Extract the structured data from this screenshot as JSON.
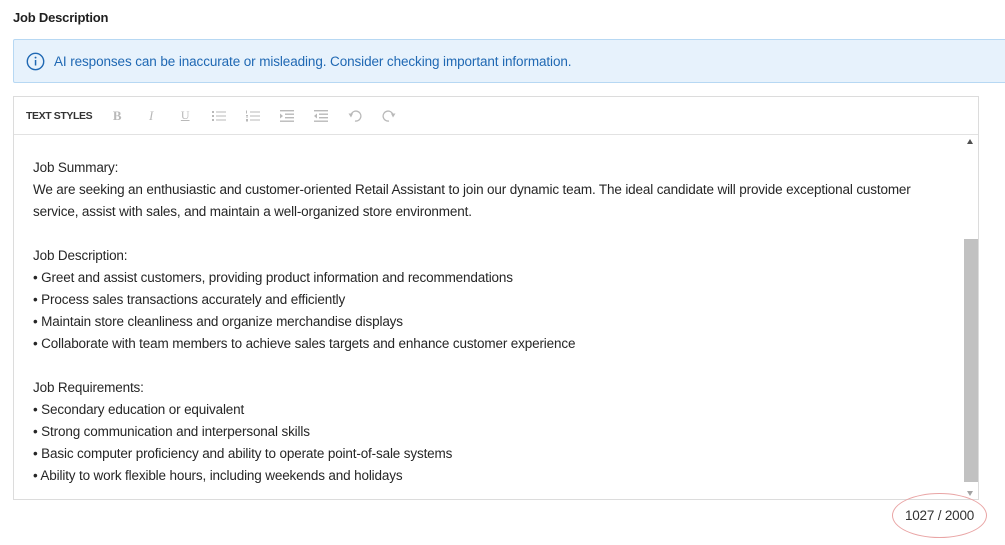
{
  "section": {
    "title": "Job Description"
  },
  "notice": {
    "icon": "info-icon",
    "text": "AI responses can be inaccurate or misleading. Consider checking important information.",
    "color": "#1f68b3",
    "background": "#e7f2fc"
  },
  "toolbar": {
    "styles_label": "TEXT STYLES",
    "buttons": [
      {
        "name": "bold-icon",
        "glyph": "B"
      },
      {
        "name": "italic-icon",
        "glyph": "I"
      },
      {
        "name": "underline-icon",
        "glyph": "U"
      },
      {
        "name": "bullet-list-icon"
      },
      {
        "name": "numbered-list-icon"
      },
      {
        "name": "indent-increase-icon"
      },
      {
        "name": "indent-decrease-icon"
      },
      {
        "name": "undo-icon"
      },
      {
        "name": "redo-icon"
      }
    ]
  },
  "editor": {
    "summary_heading": "Job Summary:",
    "summary_text": "We are seeking an enthusiastic and customer-oriented Retail Assistant to join our dynamic team. The ideal candidate will provide exceptional customer service, assist with sales, and maintain a well-organized store environment.",
    "description_heading": "Job Description:",
    "description_items": [
      "• Greet and assist customers, providing product information and recommendations",
      "• Process sales transactions accurately and efficiently",
      "• Maintain store cleanliness and organize merchandise displays",
      "• Collaborate with team members to achieve sales targets and enhance customer experience"
    ],
    "requirements_heading": "Job Requirements:",
    "requirements_items": [
      "• Secondary education or equivalent",
      "• Strong communication and interpersonal skills",
      "• Basic computer proficiency and ability to operate point-of-sale systems",
      "• Ability to work flexible hours, including weekends and holidays"
    ]
  },
  "counter": {
    "text": "1027 / 2000"
  }
}
